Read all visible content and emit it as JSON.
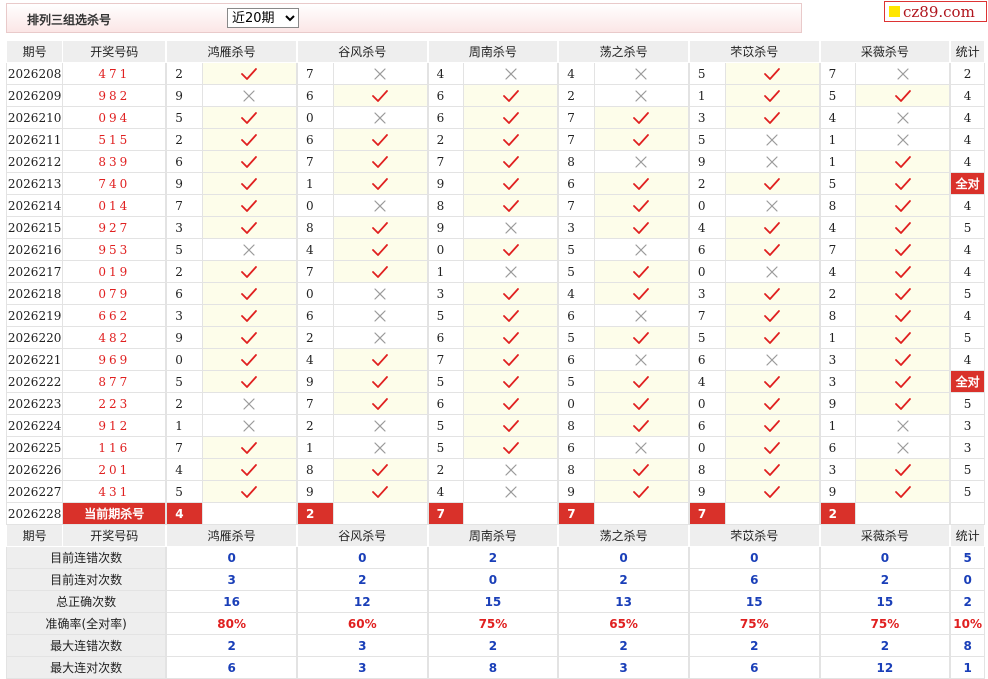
{
  "header": {
    "title": "排列三组选杀号",
    "period_select": "近20期",
    "logo_text": "cz89.com"
  },
  "columns": {
    "period": "期号",
    "number": "开奖号码",
    "stat": "统计",
    "experts": [
      "鸿雁杀号",
      "谷风杀号",
      "周南杀号",
      "荡之杀号",
      "芣苡杀号",
      "采薇杀号"
    ]
  },
  "rows": [
    {
      "period": "2026208",
      "number": "471",
      "kills": [
        {
          "k": "2",
          "ok": true
        },
        {
          "k": "7",
          "ok": false
        },
        {
          "k": "4",
          "ok": false
        },
        {
          "k": "4",
          "ok": false
        },
        {
          "k": "5",
          "ok": true
        },
        {
          "k": "7",
          "ok": false
        }
      ],
      "stat": "2"
    },
    {
      "period": "2026209",
      "number": "982",
      "kills": [
        {
          "k": "9",
          "ok": false
        },
        {
          "k": "6",
          "ok": true
        },
        {
          "k": "6",
          "ok": true
        },
        {
          "k": "2",
          "ok": false
        },
        {
          "k": "1",
          "ok": true
        },
        {
          "k": "5",
          "ok": true
        }
      ],
      "stat": "4"
    },
    {
      "period": "2026210",
      "number": "094",
      "kills": [
        {
          "k": "5",
          "ok": true
        },
        {
          "k": "0",
          "ok": false
        },
        {
          "k": "6",
          "ok": true
        },
        {
          "k": "7",
          "ok": true
        },
        {
          "k": "3",
          "ok": true
        },
        {
          "k": "4",
          "ok": false
        }
      ],
      "stat": "4"
    },
    {
      "period": "2026211",
      "number": "515",
      "kills": [
        {
          "k": "2",
          "ok": true
        },
        {
          "k": "6",
          "ok": true
        },
        {
          "k": "2",
          "ok": true
        },
        {
          "k": "7",
          "ok": true
        },
        {
          "k": "5",
          "ok": false
        },
        {
          "k": "1",
          "ok": false
        }
      ],
      "stat": "4"
    },
    {
      "period": "2026212",
      "number": "839",
      "kills": [
        {
          "k": "6",
          "ok": true
        },
        {
          "k": "7",
          "ok": true
        },
        {
          "k": "7",
          "ok": true
        },
        {
          "k": "8",
          "ok": false
        },
        {
          "k": "9",
          "ok": false
        },
        {
          "k": "1",
          "ok": true
        }
      ],
      "stat": "4"
    },
    {
      "period": "2026213",
      "number": "740",
      "kills": [
        {
          "k": "9",
          "ok": true
        },
        {
          "k": "1",
          "ok": true
        },
        {
          "k": "9",
          "ok": true
        },
        {
          "k": "6",
          "ok": true
        },
        {
          "k": "2",
          "ok": true
        },
        {
          "k": "5",
          "ok": true
        }
      ],
      "stat": "全对"
    },
    {
      "period": "2026214",
      "number": "014",
      "kills": [
        {
          "k": "7",
          "ok": true
        },
        {
          "k": "0",
          "ok": false
        },
        {
          "k": "8",
          "ok": true
        },
        {
          "k": "7",
          "ok": true
        },
        {
          "k": "0",
          "ok": false
        },
        {
          "k": "8",
          "ok": true
        }
      ],
      "stat": "4"
    },
    {
      "period": "2026215",
      "number": "927",
      "kills": [
        {
          "k": "3",
          "ok": true
        },
        {
          "k": "8",
          "ok": true
        },
        {
          "k": "9",
          "ok": false
        },
        {
          "k": "3",
          "ok": true
        },
        {
          "k": "4",
          "ok": true
        },
        {
          "k": "4",
          "ok": true
        }
      ],
      "stat": "5"
    },
    {
      "period": "2026216",
      "number": "953",
      "kills": [
        {
          "k": "5",
          "ok": false
        },
        {
          "k": "4",
          "ok": true
        },
        {
          "k": "0",
          "ok": true
        },
        {
          "k": "5",
          "ok": false
        },
        {
          "k": "6",
          "ok": true
        },
        {
          "k": "7",
          "ok": true
        }
      ],
      "stat": "4"
    },
    {
      "period": "2026217",
      "number": "019",
      "kills": [
        {
          "k": "2",
          "ok": true
        },
        {
          "k": "7",
          "ok": true
        },
        {
          "k": "1",
          "ok": false
        },
        {
          "k": "5",
          "ok": true
        },
        {
          "k": "0",
          "ok": false
        },
        {
          "k": "4",
          "ok": true
        }
      ],
      "stat": "4"
    },
    {
      "period": "2026218",
      "number": "079",
      "kills": [
        {
          "k": "6",
          "ok": true
        },
        {
          "k": "0",
          "ok": false
        },
        {
          "k": "3",
          "ok": true
        },
        {
          "k": "4",
          "ok": true
        },
        {
          "k": "3",
          "ok": true
        },
        {
          "k": "2",
          "ok": true
        }
      ],
      "stat": "5"
    },
    {
      "period": "2026219",
      "number": "662",
      "kills": [
        {
          "k": "3",
          "ok": true
        },
        {
          "k": "6",
          "ok": false
        },
        {
          "k": "5",
          "ok": true
        },
        {
          "k": "6",
          "ok": false
        },
        {
          "k": "7",
          "ok": true
        },
        {
          "k": "8",
          "ok": true
        }
      ],
      "stat": "4"
    },
    {
      "period": "2026220",
      "number": "482",
      "kills": [
        {
          "k": "9",
          "ok": true
        },
        {
          "k": "2",
          "ok": false
        },
        {
          "k": "6",
          "ok": true
        },
        {
          "k": "5",
          "ok": true
        },
        {
          "k": "5",
          "ok": true
        },
        {
          "k": "1",
          "ok": true
        }
      ],
      "stat": "5"
    },
    {
      "period": "2026221",
      "number": "969",
      "kills": [
        {
          "k": "0",
          "ok": true
        },
        {
          "k": "4",
          "ok": true
        },
        {
          "k": "7",
          "ok": true
        },
        {
          "k": "6",
          "ok": false
        },
        {
          "k": "6",
          "ok": false
        },
        {
          "k": "3",
          "ok": true
        }
      ],
      "stat": "4"
    },
    {
      "period": "2026222",
      "number": "877",
      "kills": [
        {
          "k": "5",
          "ok": true
        },
        {
          "k": "9",
          "ok": true
        },
        {
          "k": "5",
          "ok": true
        },
        {
          "k": "5",
          "ok": true
        },
        {
          "k": "4",
          "ok": true
        },
        {
          "k": "3",
          "ok": true
        }
      ],
      "stat": "全对"
    },
    {
      "period": "2026223",
      "number": "223",
      "kills": [
        {
          "k": "2",
          "ok": false
        },
        {
          "k": "7",
          "ok": true
        },
        {
          "k": "6",
          "ok": true
        },
        {
          "k": "0",
          "ok": true
        },
        {
          "k": "0",
          "ok": true
        },
        {
          "k": "9",
          "ok": true
        }
      ],
      "stat": "5"
    },
    {
      "period": "2026224",
      "number": "912",
      "kills": [
        {
          "k": "1",
          "ok": false
        },
        {
          "k": "2",
          "ok": false
        },
        {
          "k": "5",
          "ok": true
        },
        {
          "k": "8",
          "ok": true
        },
        {
          "k": "6",
          "ok": true
        },
        {
          "k": "1",
          "ok": false
        }
      ],
      "stat": "3"
    },
    {
      "period": "2026225",
      "number": "116",
      "kills": [
        {
          "k": "7",
          "ok": true
        },
        {
          "k": "1",
          "ok": false
        },
        {
          "k": "5",
          "ok": true
        },
        {
          "k": "6",
          "ok": false
        },
        {
          "k": "0",
          "ok": true
        },
        {
          "k": "6",
          "ok": false
        }
      ],
      "stat": "3"
    },
    {
      "period": "2026226",
      "number": "201",
      "kills": [
        {
          "k": "4",
          "ok": true
        },
        {
          "k": "8",
          "ok": true
        },
        {
          "k": "2",
          "ok": false
        },
        {
          "k": "8",
          "ok": true
        },
        {
          "k": "8",
          "ok": true
        },
        {
          "k": "3",
          "ok": true
        }
      ],
      "stat": "5"
    },
    {
      "period": "2026227",
      "number": "431",
      "kills": [
        {
          "k": "5",
          "ok": true
        },
        {
          "k": "9",
          "ok": true
        },
        {
          "k": "4",
          "ok": false
        },
        {
          "k": "9",
          "ok": true
        },
        {
          "k": "9",
          "ok": true
        },
        {
          "k": "9",
          "ok": true
        }
      ],
      "stat": "5"
    }
  ],
  "current": {
    "period": "2026228",
    "label": "当前期杀号",
    "kills": [
      "4",
      "2",
      "7",
      "7",
      "7",
      "2"
    ]
  },
  "stats": [
    {
      "label": "目前连错次数",
      "values": [
        "0",
        "0",
        "2",
        "0",
        "0",
        "0"
      ],
      "stat": "5",
      "red": false
    },
    {
      "label": "目前连对次数",
      "values": [
        "3",
        "2",
        "0",
        "2",
        "6",
        "2"
      ],
      "stat": "0",
      "red": false
    },
    {
      "label": "总正确次数",
      "values": [
        "16",
        "12",
        "15",
        "13",
        "15",
        "15"
      ],
      "stat": "2",
      "red": false
    },
    {
      "label": "准确率(全对率)",
      "values": [
        "80%",
        "60%",
        "75%",
        "65%",
        "75%",
        "75%"
      ],
      "stat": "10%",
      "red": true
    },
    {
      "label": "最大连错次数",
      "values": [
        "2",
        "3",
        "2",
        "2",
        "2",
        "2"
      ],
      "stat": "8",
      "red": false
    },
    {
      "label": "最大连对次数",
      "values": [
        "6",
        "3",
        "8",
        "3",
        "6",
        "12"
      ],
      "stat": "1",
      "red": false
    }
  ],
  "colors": {
    "check": "#e02020",
    "cross": "#9a9a9a",
    "highlight": "#d9312a",
    "stat_value": "#1a3fb8",
    "ok_bg": "#fdfdea"
  }
}
